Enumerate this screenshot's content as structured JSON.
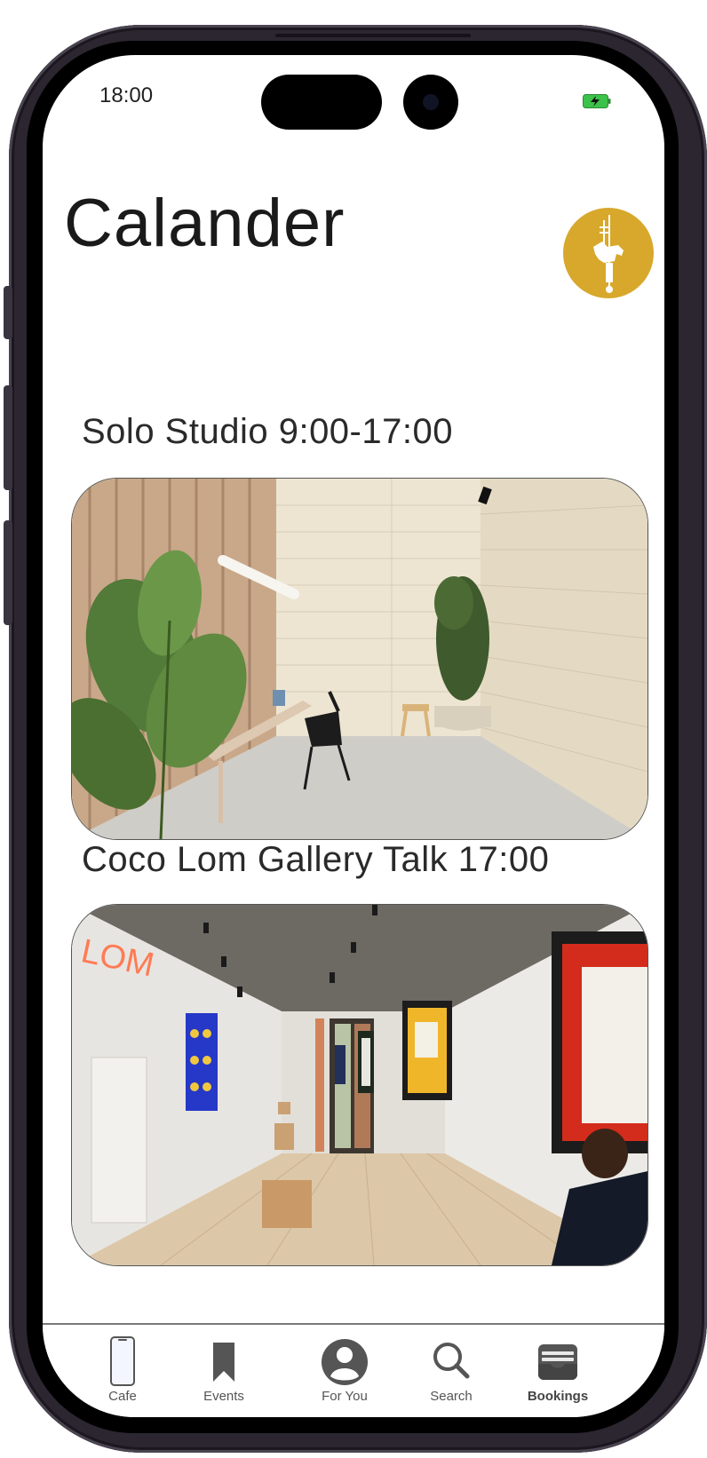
{
  "status_bar": {
    "time": "18:00"
  },
  "header": {
    "title": "Calander"
  },
  "events": [
    {
      "title": "Solo Studio 9:00-17:00",
      "image_icon": "studio-photo"
    },
    {
      "title": "Coco Lom Gallery Talk 17:00",
      "image_icon": "gallery-photo",
      "neon_sign": "LOM"
    }
  ],
  "tabbar": {
    "tabs": [
      {
        "label": "Cafe",
        "icon": "phone-icon"
      },
      {
        "label": "Events",
        "icon": "bookmark-icon"
      },
      {
        "label": "For You",
        "icon": "person-icon"
      },
      {
        "label": "Search",
        "icon": "search-icon"
      },
      {
        "label": "Bookings",
        "icon": "wallet-icon",
        "selected": true
      }
    ]
  },
  "colors": {
    "avatar_bg": "#d8a82c",
    "battery": "#3cc24a"
  }
}
